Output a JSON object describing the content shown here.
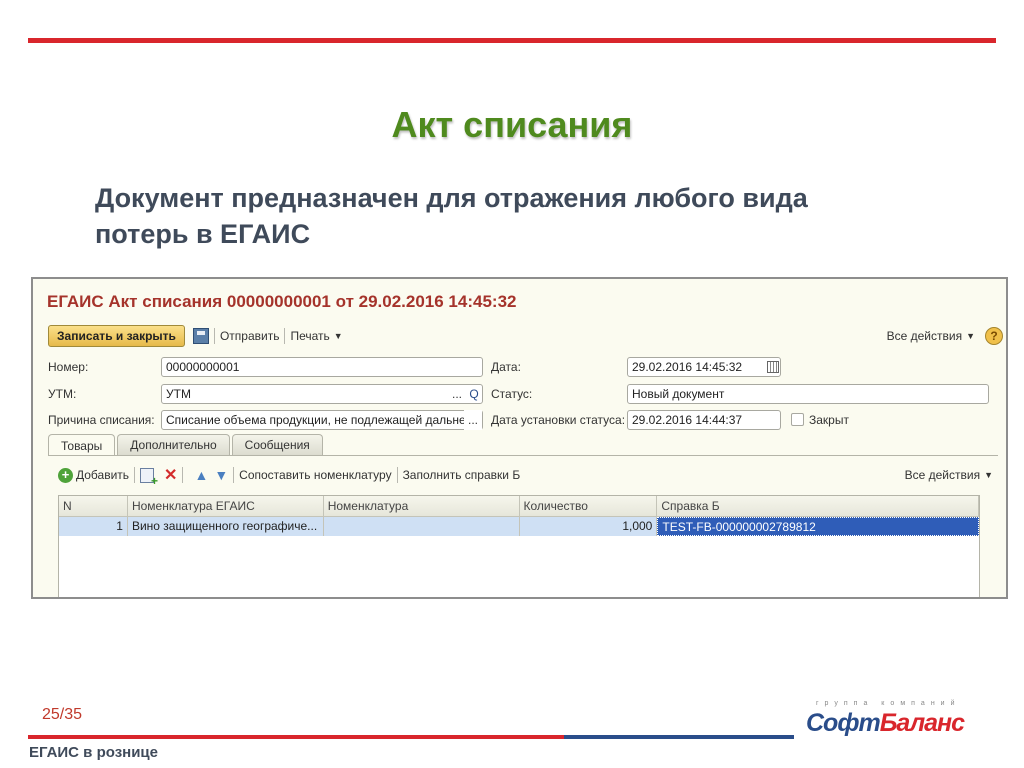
{
  "slide": {
    "title": "Акт списания",
    "subtitle_line1": "Документ предназначен для отражения любого вида",
    "subtitle_line2": "потерь в ЕГАИС",
    "page_number": "25/35",
    "footer": "ЕГАИС в рознице",
    "logo_top": "группа компаний",
    "logo_part1": "Софт",
    "logo_part2": "Баланс"
  },
  "window": {
    "title": "ЕГАИС Акт списания 00000000001 от 29.02.2016 14:45:32",
    "toolbar": {
      "save_close": "Записать и закрыть",
      "send": "Отправить",
      "print": "Печать",
      "all_actions": "Все действия",
      "help": "?"
    },
    "form": {
      "number_label": "Номер:",
      "number_value": "00000000001",
      "date_label": "Дата:",
      "date_value": "29.02.2016 14:45:32",
      "utm_label": "УТМ:",
      "utm_value": "УТМ",
      "status_label": "Статус:",
      "status_value": "Новый документ",
      "reason_label": "Причина списания:",
      "reason_value": "Списание объема продукции, не подлежащей дальнейшей",
      "status_date_label": "Дата установки статуса:",
      "status_date_value": "29.02.2016 14:44:37",
      "closed_label": "Закрыт",
      "ellipsis": "...",
      "search_glyph": "Q"
    },
    "tabs": [
      "Товары",
      "Дополнительно",
      "Сообщения"
    ],
    "tab_toolbar": {
      "add": "Добавить",
      "match": "Сопоставить номенклатуру",
      "fill": "Заполнить справки Б",
      "all_actions": "Все действия"
    },
    "grid": {
      "columns": [
        "N",
        "Номенклатура ЕГАИС",
        "Номенклатура",
        "Количество",
        "Справка Б"
      ],
      "rows": [
        [
          "1",
          "Вино защищенного географиче...",
          "",
          "1,000",
          "TEST-FB-000000002789812"
        ]
      ]
    }
  }
}
